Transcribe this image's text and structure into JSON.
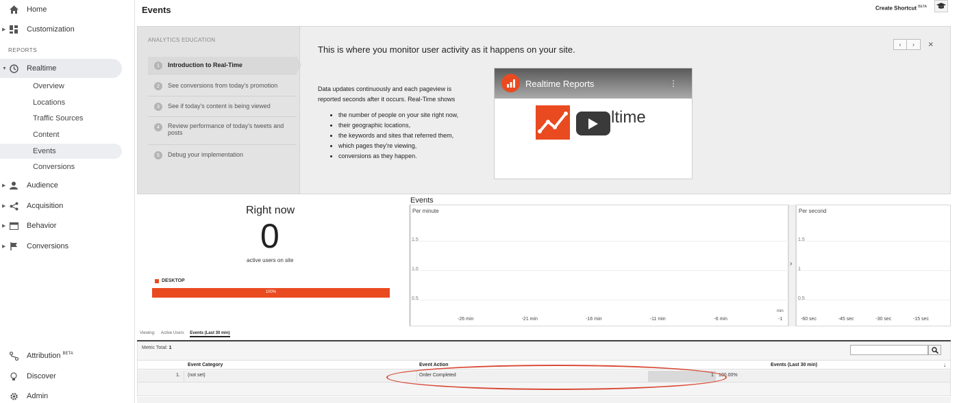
{
  "sidebar": {
    "home": "Home",
    "customization": "Customization",
    "reports_header": "REPORTS",
    "realtime": "Realtime",
    "realtime_items": [
      "Overview",
      "Locations",
      "Traffic Sources",
      "Content",
      "Events",
      "Conversions"
    ],
    "audience": "Audience",
    "acquisition": "Acquisition",
    "behavior": "Behavior",
    "conversions": "Conversions",
    "attribution": "Attribution",
    "attribution_badge": "BETA",
    "discover": "Discover",
    "admin": "Admin"
  },
  "header": {
    "title": "Events",
    "shortcut": "Create Shortcut",
    "shortcut_badge": "BETA",
    "shortcut_icon": "graduation-cap-icon"
  },
  "education": {
    "header": "ANALYTICS EDUCATION",
    "steps": [
      {
        "num": "1",
        "text": "Introduction to Real-Time"
      },
      {
        "num": "2",
        "text": "See conversions from today's promotion"
      },
      {
        "num": "3",
        "text": "See if today's content is being viewed"
      },
      {
        "num": "4",
        "text": "Review performance of today's tweets and posts"
      },
      {
        "num": "5",
        "text": "Debug your implementation"
      }
    ],
    "headline": "This is where you monitor user activity as it happens on your site.",
    "description": "Data updates continuously and each pageview is reported seconds after it occurs. Real-Time shows",
    "bullets": [
      "the number of people on your site right now,",
      "their geographic locations,",
      "the keywords and sites that referred them,",
      "which pages they're viewing,",
      "conversions as they happen."
    ],
    "video_title": "Realtime Reports",
    "video_word": "ltime",
    "nav_prev": "‹",
    "nav_next": "›",
    "close": "×"
  },
  "right_now": {
    "title": "Right now",
    "value": "0",
    "subtitle": "active users on site",
    "legend": "DESKTOP",
    "bar_label": "100%",
    "bar_fraction": 1.0,
    "accent": "#e94a20"
  },
  "events_chart": {
    "title": "Events",
    "per_minute": "Per minute",
    "per_second": "Per second",
    "unit_min": "min",
    "expand_arrow": "›"
  },
  "chart_data": [
    {
      "type": "bar",
      "title": "Per minute",
      "y_ticks": [
        "1.5",
        "1.0",
        "0.5"
      ],
      "x_ticks": [
        "-26 min",
        "-21 min",
        "-16 min",
        "-11 min",
        "-6 min",
        "-1"
      ],
      "values": []
    },
    {
      "type": "bar",
      "title": "Per second",
      "y_ticks": [
        "1.5",
        "1",
        "0.5"
      ],
      "x_ticks": [
        "-60 sec",
        "-45 sec",
        "-30 sec",
        "-15 sec"
      ],
      "values": []
    }
  ],
  "viewing": {
    "label": "Viewing:",
    "tab_active_users": "Active Users",
    "tab_events": "Events (Last 30 min)"
  },
  "table": {
    "metric_label": "Metric Total:",
    "metric_value": "1",
    "search_icon": "search-icon",
    "headers": {
      "category": "Event Category",
      "action": "Event Action",
      "events": "Events (Last 30 min)"
    },
    "rows": [
      {
        "num": "1.",
        "category": "(not set)",
        "action": "Order Completed",
        "count": "1",
        "percent": "100.00%"
      }
    ]
  },
  "annotation_color": "#d84a36"
}
